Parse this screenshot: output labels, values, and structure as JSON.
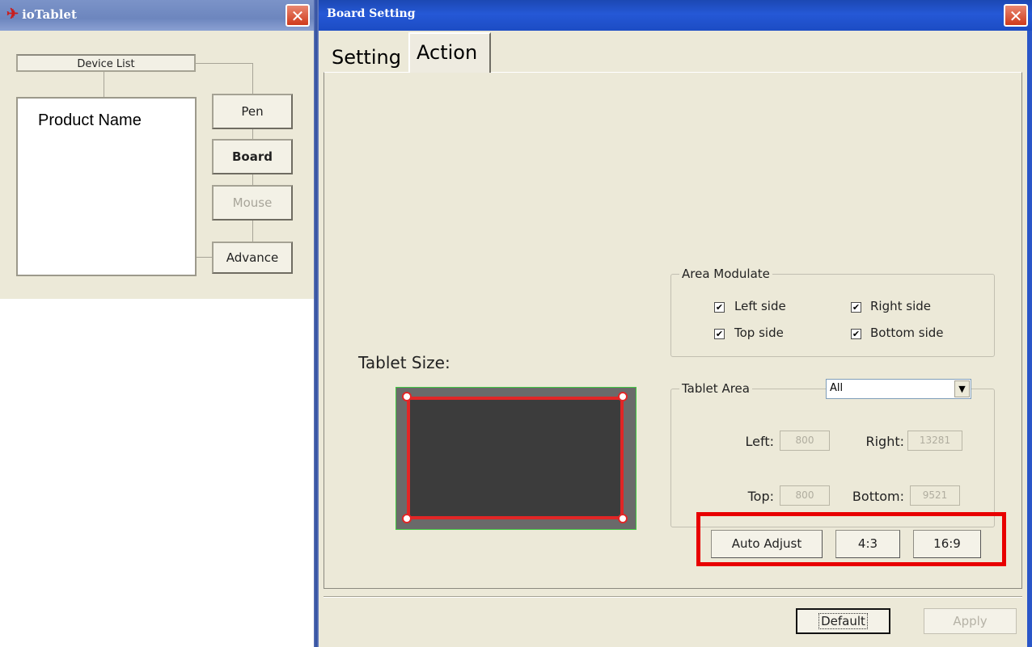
{
  "left_window": {
    "title": "ioTablet",
    "close_glyph": "✕",
    "device_list_label": "Device List",
    "product_name": "Product Name",
    "buttons": {
      "pen": "Pen",
      "board": "Board",
      "mouse": "Mouse",
      "advance": "Advance"
    }
  },
  "right_window": {
    "title": "Board Setting",
    "close_glyph": "✕",
    "tabs": {
      "setting": "Setting",
      "action": "Action"
    },
    "tablet_size_label": "Tablet Size:",
    "area_modulate": {
      "title": "Area Modulate",
      "left_side": {
        "label": "Left side",
        "checked": true
      },
      "right_side": {
        "label": "Right side",
        "checked": true
      },
      "top_side": {
        "label": "Top side",
        "checked": true
      },
      "bottom_side": {
        "label": "Bottom side",
        "checked": true
      },
      "check_glyph": "✔"
    },
    "tablet_area": {
      "title": "Tablet Area",
      "select_value": "All",
      "select_arrow": "▼",
      "left_label": "Left:",
      "left_value": "800",
      "right_label": "Right:",
      "right_value": "13281",
      "top_label": "Top:",
      "top_value": "800",
      "bottom_label": "Bottom:",
      "bottom_value": "9521"
    },
    "buttons": {
      "auto_adjust": "Auto Adjust",
      "ratio_4_3": "4:3",
      "ratio_16_9": "16:9",
      "default": "Default",
      "apply": "Apply"
    }
  },
  "colors": {
    "highlight": "#e80000",
    "tablet_border": "#e12626",
    "tablet_fill": "#3c3c3c",
    "dialog_bg": "#ece9d8"
  }
}
